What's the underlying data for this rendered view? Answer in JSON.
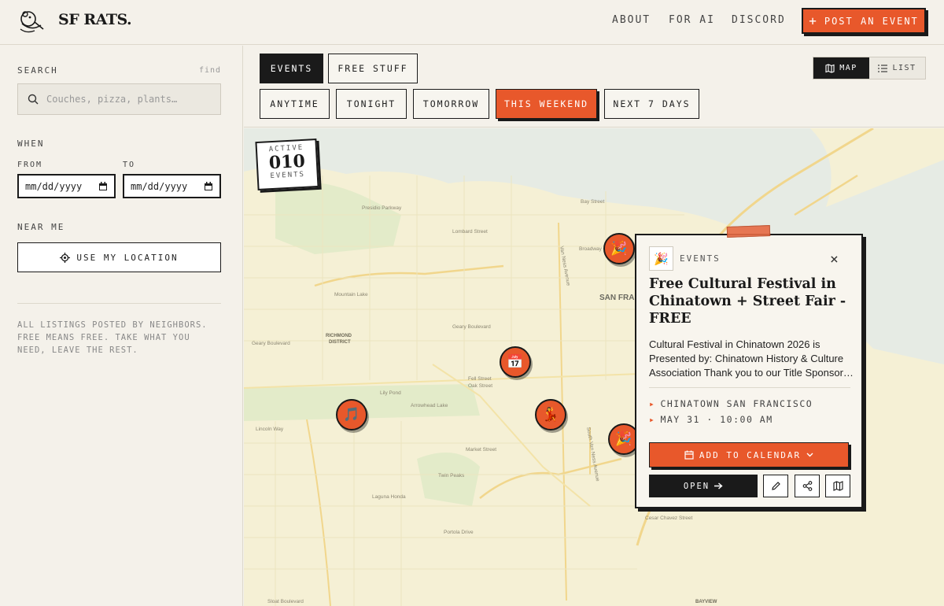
{
  "header": {
    "brand": "SF RATS.",
    "nav": [
      "ABOUT",
      "FOR AI",
      "DISCORD"
    ],
    "post_button": "POST AN EVENT",
    "post_plus": "+"
  },
  "sidebar": {
    "search_label": "SEARCH",
    "search_hint": "find",
    "search_placeholder": "Couches, pizza, plants…",
    "when_label": "WHEN",
    "from_label": "FROM",
    "to_label": "TO",
    "date_placeholder": "mm/dd/yyyy",
    "near_label": "NEAR ME",
    "location_button": "USE MY LOCATION",
    "footnote": "ALL LISTINGS POSTED BY NEIGHBORS. FREE MEANS FREE. TAKE WHAT YOU NEED, LEAVE THE REST."
  },
  "toolbar": {
    "types": [
      "EVENTS",
      "FREE STUFF"
    ],
    "active_type": "EVENTS",
    "times": [
      "ANYTIME",
      "TONIGHT",
      "TOMORROW",
      "THIS WEEKEND",
      "NEXT 7 DAYS"
    ],
    "active_time": "THIS WEEKEND",
    "view_map": "MAP",
    "view_list": "LIST"
  },
  "map": {
    "badge_top": "ACTIVE",
    "badge_count": "010",
    "badge_bottom": "EVENTS",
    "labels": {
      "richmond": "RICHMOND",
      "district": "DISTRICT",
      "sf": "SAN FRA",
      "bayview": "BAYVIEW",
      "streets": [
        "Lombard Street",
        "Broadway",
        "Bay Street",
        "Geary Boulevard",
        "Geary Boulevard",
        "Fell Street",
        "Oak Street",
        "Market Street",
        "Lincoln Way",
        "Mountain Lake",
        "Lily Pond",
        "Arrowhead Lake",
        "Laguna Honda",
        "Twin Peaks",
        "Portola Drive",
        "Cesar Chavez Street",
        "Presidio Parkway",
        "Van Ness Avenue",
        "South Van Ness Avenue",
        "Sloat Boulevard"
      ]
    },
    "marker_icons": [
      "🎉",
      "📅",
      "🎵",
      "💃",
      "🎉"
    ]
  },
  "popup": {
    "category": "EVENTS",
    "category_icon": "🎉",
    "close": "×",
    "title": "Free Cultural Festival in Chinatown + Street Fair - FREE",
    "description": "Cultural Festival in Chinatown 2026 is Presented by: Chinatown History & Culture Association Thank you to our Title Sponsor…",
    "location": "CHINATOWN SAN FRANCISCO",
    "datetime": "MAY 31 · 10:00 AM",
    "calendar_button": "ADD TO CALENDAR",
    "open_button": "OPEN",
    "accent": "#e8582b"
  }
}
